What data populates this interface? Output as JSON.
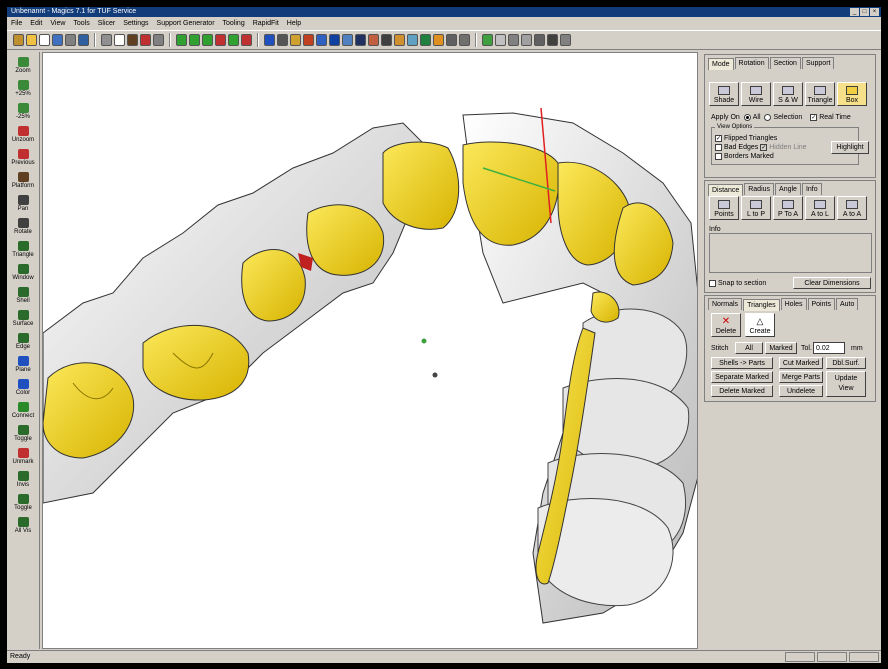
{
  "app": {
    "title": "Unbenannt - Magics 7.1 for TUF Service"
  },
  "menu": [
    "File",
    "Edit",
    "View",
    "Tools",
    "Slicer",
    "Settings",
    "Support Generator",
    "Tooling",
    "RapidFit",
    "Help"
  ],
  "left_tools": [
    {
      "label": "Zoom",
      "icon": "magnifier-icon"
    },
    {
      "label": "+25%",
      "icon": "zoom-in-icon"
    },
    {
      "label": "-25%",
      "icon": "zoom-out-icon"
    },
    {
      "label": "Unzoom",
      "icon": "unzoom-icon"
    },
    {
      "label": "Previous",
      "icon": "previous-view-icon"
    },
    {
      "label": "Platform",
      "icon": "platform-icon"
    },
    {
      "label": "Pan",
      "icon": "pan-icon"
    },
    {
      "label": "Rotate",
      "icon": "rotate-icon"
    },
    {
      "label": "Triangle",
      "icon": "triangle-mark-icon"
    },
    {
      "label": "Window",
      "icon": "window-mark-icon"
    },
    {
      "label": "Shell",
      "icon": "shell-mark-icon"
    },
    {
      "label": "Surface",
      "icon": "surface-mark-icon"
    },
    {
      "label": "Edge",
      "icon": "edge-mark-icon"
    },
    {
      "label": "Plane",
      "icon": "plane-mark-icon"
    },
    {
      "label": "Color",
      "icon": "color-mark-icon"
    },
    {
      "label": "Connect",
      "icon": "connect-icon"
    },
    {
      "label": "Toggle",
      "icon": "toggle-icon"
    },
    {
      "label": "Unmark",
      "icon": "unmark-icon"
    },
    {
      "label": "Invis",
      "icon": "invisible-icon"
    },
    {
      "label": "Toggle",
      "icon": "toggle-visibility-icon"
    },
    {
      "label": "All Vis",
      "icon": "all-visible-icon"
    }
  ],
  "panel": {
    "view_tabs": [
      "Mode",
      "Rotation",
      "Section",
      "Support"
    ],
    "view_buttons": [
      {
        "label": "Shade",
        "icon": "shade-icon"
      },
      {
        "label": "Wire",
        "icon": "wireframe-icon"
      },
      {
        "label": "S & W",
        "icon": "shade-wire-icon"
      },
      {
        "label": "Triangle",
        "icon": "triangle-view-icon"
      },
      {
        "label": "Box",
        "icon": "box-icon"
      }
    ],
    "apply_on": "Apply On",
    "apply_all": "All",
    "apply_selection": "Selection",
    "real_time": "Real Time",
    "view_options_title": "View Options",
    "flipped_triangles": "Flipped Triangles",
    "bad_edges": "Bad Edges",
    "hidden_line": "Hidden Line",
    "borders_marked": "Borders Marked",
    "highlight": "Highlight",
    "measure_tabs": [
      "Distance",
      "Radius",
      "Angle",
      "Info"
    ],
    "measure_buttons": [
      {
        "label": "Points",
        "icon": "points-measure-icon"
      },
      {
        "label": "L to P",
        "icon": "line-to-point-icon"
      },
      {
        "label": "P To A",
        "icon": "point-to-arc-icon"
      },
      {
        "label": "A to L",
        "icon": "arc-to-line-icon"
      },
      {
        "label": "A to A",
        "icon": "arc-to-arc-icon"
      }
    ],
    "info_label": "Info",
    "snap_to_section": "Snap to section",
    "clear_dimensions": "Clear Dimensions",
    "edit_tabs": [
      "Normals",
      "Triangles",
      "Holes",
      "Points",
      "Auto"
    ],
    "delete": "Delete",
    "create": "Create",
    "stitch": "Stitch",
    "all": "All",
    "marked": "Marked",
    "tol": "Tol.",
    "tol_value": "0.02",
    "unit": "mm",
    "shells_parts": "Shells -> Parts",
    "cut_marked": "Cut Marked",
    "dbl_surf": "Dbl.Surf.",
    "separate_marked": "Separate Marked",
    "merge_parts": "Merge Parts",
    "update_view": "Update View",
    "delete_marked": "Delete Marked",
    "undelete": "Undelete"
  },
  "status": "Ready",
  "colors": {
    "tooth_yellow": "#f2d41f",
    "tooth_grey": "#e2e2e2",
    "title_bar": "#123c7a"
  }
}
